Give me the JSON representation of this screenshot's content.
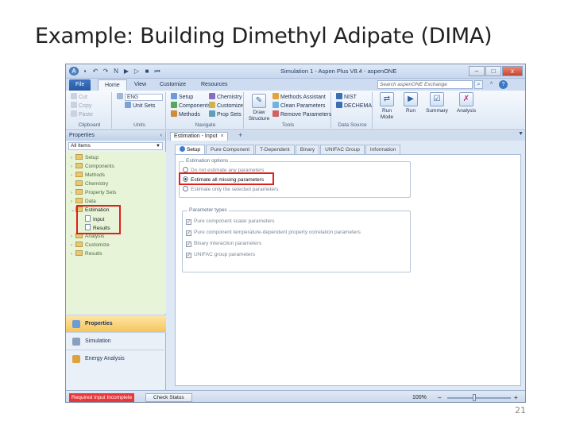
{
  "slide": {
    "title": "Example: Building Dimethyl Adipate (DIMA)",
    "page_number": "21"
  },
  "window": {
    "title": "Simulation 1 - Aspen Plus V8.4 - aspenONE",
    "controls": [
      "–",
      "□",
      "x"
    ]
  },
  "ribbon_tabs": [
    "File",
    "Home",
    "View",
    "Customize",
    "Resources"
  ],
  "search": {
    "placeholder": "Search aspenONE Exchange"
  },
  "ribbon": {
    "clipboard": {
      "cut": "Cut",
      "copy": "Copy",
      "paste": "Paste",
      "label": "Clipboard"
    },
    "units": {
      "value": "ENG",
      "unit_sets": "Unit Sets",
      "label": "Units"
    },
    "navigate": {
      "setup": "Setup",
      "components": "Components",
      "methods": "Methods",
      "chemistry": "Chemistry",
      "customize": "Customize",
      "prop_sets": "Prop Sets",
      "label": "Navigate"
    },
    "tools": {
      "draw_structure": "Draw Structure",
      "methods_assistant": "Methods Assistant",
      "clean_parameters": "Clean Parameters",
      "remove_parameters": "Remove Parameters",
      "label": "Tools"
    },
    "data_source": {
      "nist": "NIST",
      "dechema": "DECHEMA",
      "label": "Data Source"
    },
    "run": {
      "run_mode": "Run Mode",
      "run": "Run",
      "summary": "Summary",
      "analysis": "Analysis"
    }
  },
  "left_pane": {
    "header": "Properties",
    "filter": "All Items",
    "tree": [
      "Setup",
      "Components",
      "Methods",
      "Chemistry",
      "Property Sets",
      "Data",
      "Estimation",
      "Input",
      "Results",
      "Analysis",
      "Customize",
      "Results"
    ],
    "nav": [
      "Properties",
      "Simulation",
      "Energy Analysis"
    ]
  },
  "doc_tab": {
    "label": "Estimation - Input",
    "close": "×"
  },
  "form_tabs": [
    "Setup",
    "Pure Component",
    "T-Dependent",
    "Binary",
    "UNIFAC Group",
    "Information"
  ],
  "estimation_options": {
    "title": "Estimation options",
    "options": [
      "Do not estimate any parameters",
      "Estimate all missing parameters",
      "Estimate only the selected parameters"
    ]
  },
  "parameter_types": {
    "title": "Parameter types",
    "items": [
      "Pure component scalar parameters",
      "Pure component temperature-dependent property correlation parameters",
      "Binary interaction parameters",
      "UNIFAC group parameters"
    ]
  },
  "status_bar": {
    "required": "Required Input Incomplete",
    "check_status": "Check Status",
    "zoom": "100%",
    "zoom_fraction": 0.5,
    "minus": "–",
    "plus": "+"
  },
  "colors": {
    "highlight_red": "#e0201b",
    "tree_bg": "#e7f4d8",
    "status_red": "#e8373a"
  }
}
